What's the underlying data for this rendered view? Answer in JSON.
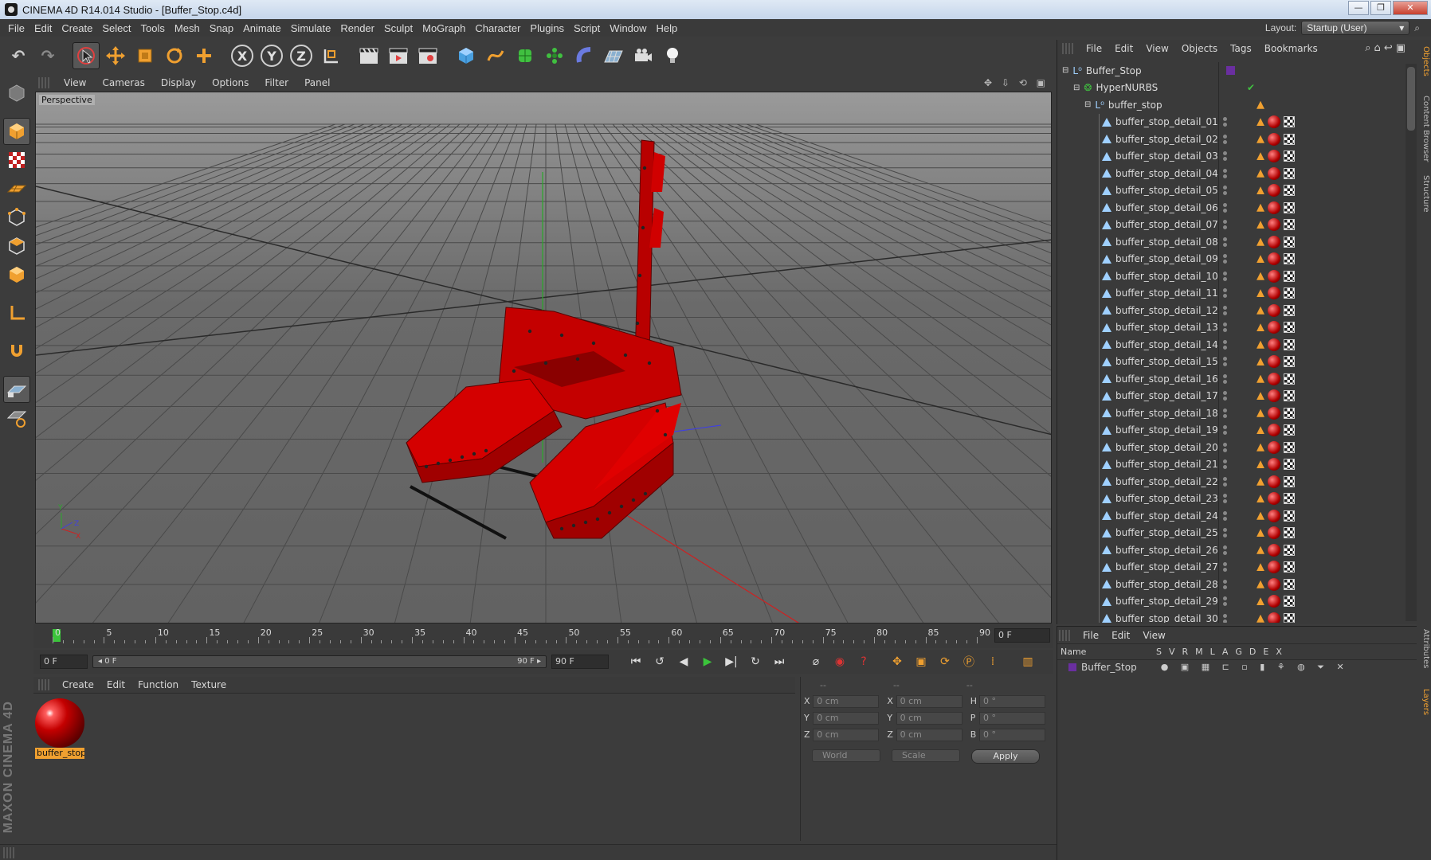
{
  "window": {
    "title": "CINEMA 4D R14.014 Studio - [Buffer_Stop.c4d]",
    "minimize": "—",
    "maximize": "❐",
    "close": "✕"
  },
  "menubar": {
    "items": [
      "File",
      "Edit",
      "Create",
      "Select",
      "Tools",
      "Mesh",
      "Snap",
      "Animate",
      "Simulate",
      "Render",
      "Sculpt",
      "MoGraph",
      "Character",
      "Plugins",
      "Script",
      "Window",
      "Help"
    ],
    "layout_label": "Layout:",
    "layout_value": "Startup (User)"
  },
  "toolbar": {
    "undo": "↶",
    "redo": "↷",
    "axes": [
      "X",
      "Y",
      "Z"
    ]
  },
  "viewport": {
    "menu": [
      "View",
      "Cameras",
      "Display",
      "Options",
      "Filter",
      "Panel"
    ],
    "label": "Perspective",
    "colors": {
      "model": "#c80000",
      "grid": "#505050",
      "axis_y": "#2aa82a",
      "axis_x": "#d02020",
      "axis_z": "#4040e0"
    }
  },
  "timeline": {
    "ticks": [
      "0",
      "5",
      "10",
      "15",
      "20",
      "25",
      "30",
      "35",
      "40",
      "45",
      "50",
      "55",
      "60",
      "65",
      "70",
      "75",
      "80",
      "85",
      "90"
    ],
    "current_frame": "0 F",
    "start_field": "0 F",
    "slider_start": "◂ 0 F",
    "slider_end": "90 F ▸",
    "end_field": "90 F"
  },
  "materials": {
    "menu": [
      "Create",
      "Edit",
      "Function",
      "Texture"
    ],
    "items": [
      {
        "name": "buffer_stop"
      }
    ]
  },
  "coordinates": {
    "headers": [
      "--",
      "--",
      "--"
    ],
    "rows": [
      {
        "a1": "X",
        "v1": "0 cm",
        "a2": "X",
        "v2": "0 cm",
        "a3": "H",
        "v3": "0 °"
      },
      {
        "a1": "Y",
        "v1": "0 cm",
        "a2": "Y",
        "v2": "0 cm",
        "a3": "P",
        "v3": "0 °"
      },
      {
        "a1": "Z",
        "v1": "0 cm",
        "a2": "Z",
        "v2": "0 cm",
        "a3": "B",
        "v3": "0 °"
      }
    ],
    "mode": "World",
    "scale": "Scale",
    "apply": "Apply"
  },
  "objects": {
    "menu": [
      "File",
      "Edit",
      "View",
      "Objects",
      "Tags",
      "Bookmarks"
    ],
    "tree": [
      {
        "name": "Buffer_Stop",
        "level": 0
      },
      {
        "name": "HyperNURBS",
        "level": 1
      },
      {
        "name": "buffer_stop",
        "level": 2
      }
    ],
    "details": [
      "buffer_stop_detail_01",
      "buffer_stop_detail_02",
      "buffer_stop_detail_03",
      "buffer_stop_detail_04",
      "buffer_stop_detail_05",
      "buffer_stop_detail_06",
      "buffer_stop_detail_07",
      "buffer_stop_detail_08",
      "buffer_stop_detail_09",
      "buffer_stop_detail_10",
      "buffer_stop_detail_11",
      "buffer_stop_detail_12",
      "buffer_stop_detail_13",
      "buffer_stop_detail_14",
      "buffer_stop_detail_15",
      "buffer_stop_detail_16",
      "buffer_stop_detail_17",
      "buffer_stop_detail_18",
      "buffer_stop_detail_19",
      "buffer_stop_detail_20",
      "buffer_stop_detail_21",
      "buffer_stop_detail_22",
      "buffer_stop_detail_23",
      "buffer_stop_detail_24",
      "buffer_stop_detail_25",
      "buffer_stop_detail_26",
      "buffer_stop_detail_27",
      "buffer_stop_detail_28",
      "buffer_stop_detail_29",
      "buffer_stop_detail_30"
    ]
  },
  "layers": {
    "menu": [
      "File",
      "Edit",
      "View"
    ],
    "columns": [
      "Name",
      "S",
      "V",
      "R",
      "M",
      "L",
      "A",
      "G",
      "D",
      "E",
      "X"
    ],
    "rows": [
      {
        "name": "Buffer_Stop"
      }
    ]
  },
  "sidetabs": [
    "Objects",
    "Content Browser",
    "Structure",
    "Attributes",
    "Layers"
  ],
  "brand": "MAXON CINEMA 4D"
}
